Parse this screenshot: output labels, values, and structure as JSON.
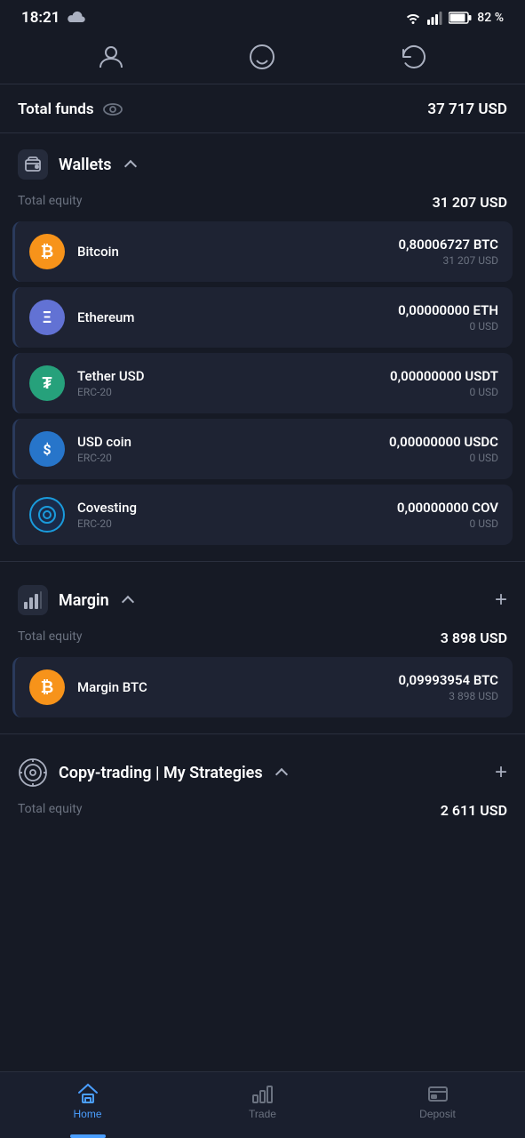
{
  "statusBar": {
    "time": "18:21",
    "battery": "82 %"
  },
  "totalFunds": {
    "label": "Total funds",
    "amount": "37 717 USD"
  },
  "wallets": {
    "sectionTitle": "Wallets",
    "totalEquityLabel": "Total equity",
    "totalEquityAmount": "31 207 USD",
    "items": [
      {
        "name": "Bitcoin",
        "subtitle": "",
        "iconColor": "#f7931a",
        "iconSymbol": "₿",
        "cryptoAmount": "0,80006727 BTC",
        "usdAmount": "31 207 USD",
        "borderColor": "#3a5a8c"
      },
      {
        "name": "Ethereum",
        "subtitle": "",
        "iconColor": "#6272d4",
        "iconSymbol": "Ξ",
        "cryptoAmount": "0,00000000 ETH",
        "usdAmount": "0 USD",
        "borderColor": "#3a5a8c"
      },
      {
        "name": "Tether USD",
        "subtitle": "ERC-20",
        "iconColor": "#26a17b",
        "iconSymbol": "₮",
        "cryptoAmount": "0,00000000 USDT",
        "usdAmount": "0 USD",
        "borderColor": "#3a5a8c"
      },
      {
        "name": "USD coin",
        "subtitle": "ERC-20",
        "iconColor": "#2775ca",
        "iconSymbol": "$",
        "cryptoAmount": "0,00000000 USDC",
        "usdAmount": "0 USD",
        "borderColor": "#3a5a8c"
      },
      {
        "name": "Covesting",
        "subtitle": "ERC-20",
        "iconColor": "#1a9bdc",
        "iconSymbol": "◎",
        "cryptoAmount": "0,00000000 COV",
        "usdAmount": "0 USD",
        "borderColor": "#3a5a8c"
      }
    ]
  },
  "margin": {
    "sectionTitle": "Margin",
    "totalEquityLabel": "Total equity",
    "totalEquityAmount": "3 898 USD",
    "items": [
      {
        "name": "Margin BTC",
        "subtitle": "",
        "iconColor": "#f7931a",
        "iconSymbol": "₿",
        "cryptoAmount": "0,09993954 BTC",
        "usdAmount": "3 898 USD",
        "borderColor": "#3a5a8c"
      }
    ]
  },
  "copyTrading": {
    "sectionTitle": "Copy-trading | My Strategies",
    "totalEquityLabel": "Total equity",
    "totalEquityAmount": "2 611 USD"
  },
  "bottomNav": {
    "items": [
      {
        "label": "Home",
        "active": true
      },
      {
        "label": "Trade",
        "active": false
      },
      {
        "label": "Deposit",
        "active": false
      }
    ]
  }
}
